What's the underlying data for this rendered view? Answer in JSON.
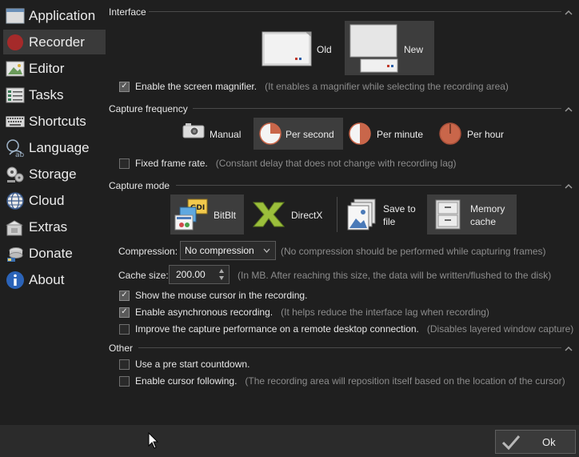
{
  "sidebar": {
    "items": [
      {
        "label": "Application",
        "icon": "application-window-icon"
      },
      {
        "label": "Recorder",
        "icon": "record-icon",
        "active": true
      },
      {
        "label": "Editor",
        "icon": "image-editor-icon"
      },
      {
        "label": "Tasks",
        "icon": "task-list-icon"
      },
      {
        "label": "Shortcuts",
        "icon": "keyboard-icon"
      },
      {
        "label": "Language",
        "icon": "translate-icon"
      },
      {
        "label": "Storage",
        "icon": "storage-gears-icon"
      },
      {
        "label": "Cloud",
        "icon": "globe-icon"
      },
      {
        "label": "Extras",
        "icon": "extras-box-icon"
      },
      {
        "label": "Donate",
        "icon": "donate-coins-icon"
      },
      {
        "label": "About",
        "icon": "info-icon"
      }
    ]
  },
  "interface": {
    "title": "Interface",
    "old_label": "Old",
    "new_label": "New",
    "selected": "New",
    "magnifier_label": "Enable the screen magnifier.",
    "magnifier_hint": "(It enables a magnifier while selecting the recording area)",
    "magnifier_checked": true
  },
  "capture_frequency": {
    "title": "Capture frequency",
    "options": [
      "Manual",
      "Per second",
      "Per minute",
      "Per hour"
    ],
    "selected": "Per second",
    "fixed_label": "Fixed frame rate.",
    "fixed_hint": "(Constant delay that does not change with recording lag)",
    "fixed_checked": false
  },
  "capture_mode": {
    "title": "Capture mode",
    "bitblt_label": "BitBlt",
    "directx_label": "DirectX",
    "save_label_1": "Save to",
    "save_label_2": "file",
    "memory_label_1": "Memory",
    "memory_label_2": "cache",
    "selected_mode": "BitBlt",
    "selected_storage": "Memory cache",
    "compression_label": "Compression:",
    "compression_value": "No compression",
    "compression_hint": "(No compression should be performed while capturing frames)",
    "cache_label": "Cache size:",
    "cache_value": "200.00",
    "cache_hint": "(In MB. After reaching this size, the data will be written/flushed to the disk)",
    "cursor_label": "Show the mouse cursor in the recording.",
    "cursor_checked": true,
    "async_label": "Enable asynchronous recording.",
    "async_hint": "(It helps reduce the interface lag when recording)",
    "async_checked": true,
    "remote_label": "Improve the capture performance on a remote desktop connection.",
    "remote_hint": "(Disables layered window capture)",
    "remote_checked": false
  },
  "other": {
    "title": "Other",
    "countdown_label": "Use a pre start countdown.",
    "countdown_checked": false,
    "follow_label": "Enable cursor following.",
    "follow_hint": "(The recording area will reposition itself based on the location of the cursor)",
    "follow_checked": false
  },
  "footer": {
    "ok_label": "Ok"
  },
  "colors": {
    "background": "#1f1f1f",
    "selected": "#3d3d3d",
    "hint": "#8c8c8c",
    "record_red": "#a52a2a",
    "clock_orange": "#c9664a",
    "directx_green": "#9bbf3b"
  }
}
